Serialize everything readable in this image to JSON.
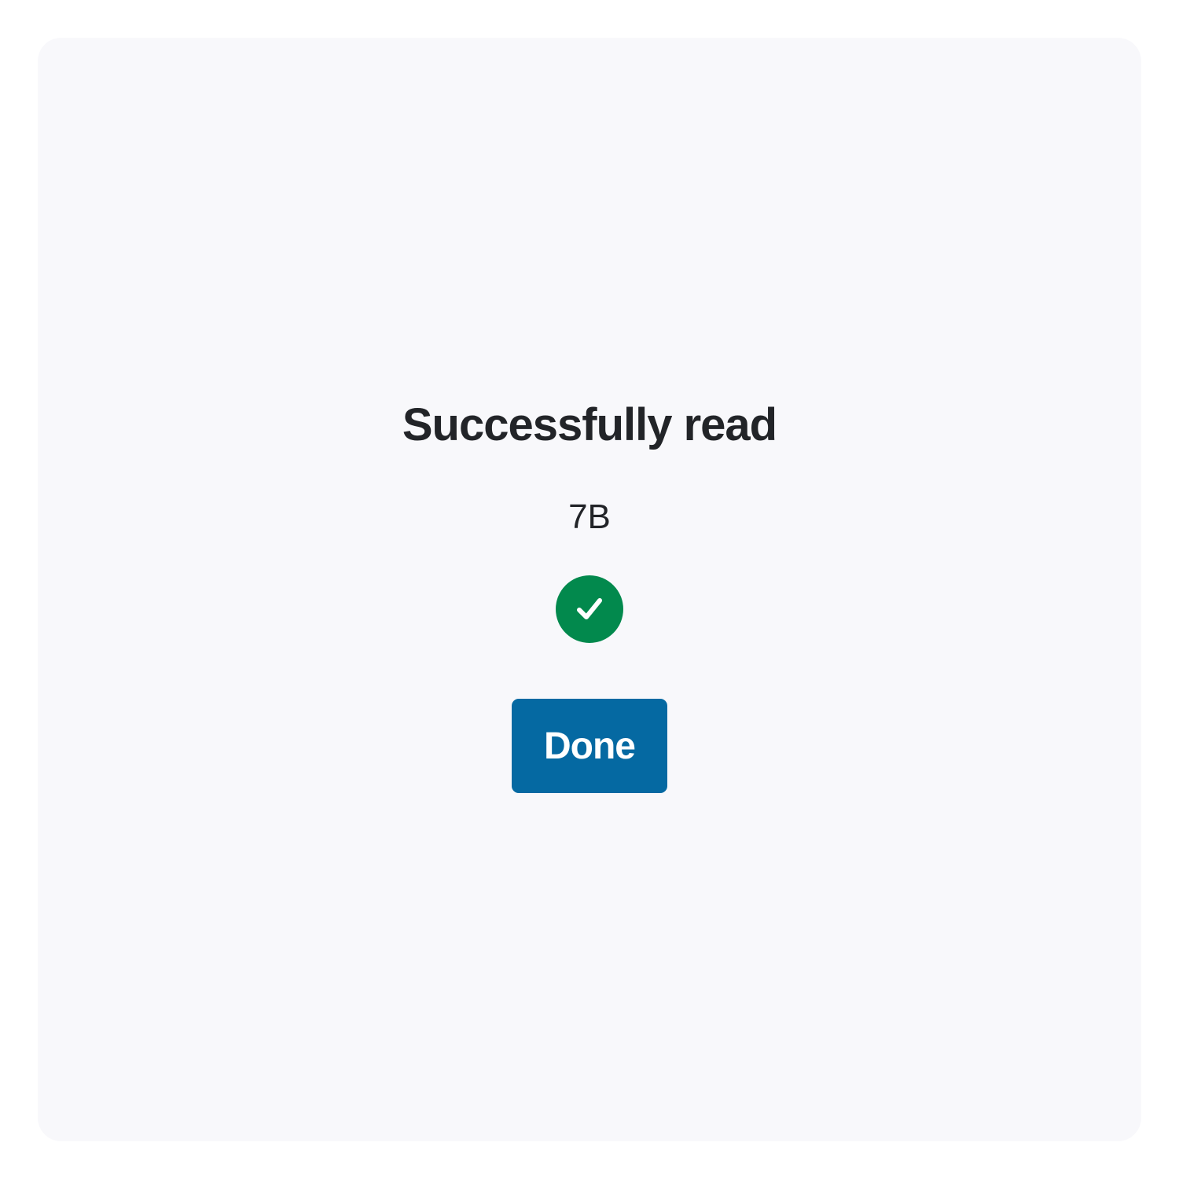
{
  "dialog": {
    "title": "Successfully read",
    "size": "7B",
    "status_icon": "check-circle-icon",
    "done_label": "Done"
  },
  "colors": {
    "panel_background": "#f8f8fb",
    "text": "#222428",
    "success": "#02894d",
    "primary_button": "#0569a2"
  }
}
